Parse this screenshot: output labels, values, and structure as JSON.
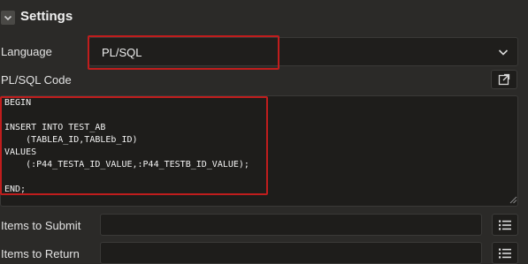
{
  "settings": {
    "title": "Settings",
    "toggle_icon": "chevron-down-icon"
  },
  "language": {
    "label": "Language",
    "value": "PL/SQL",
    "dropdown_icon": "chevron-down-icon"
  },
  "code": {
    "label": "PL/SQL Code",
    "expand_icon": "expand-icon",
    "text": "BEGIN\n\nINSERT INTO TEST_AB\n    (TABLEA_ID,TABLEb_ID)\nVALUES\n    (:P44_TESTA_ID_VALUE,:P44_TESTB_ID_VALUE);\n\nEND;"
  },
  "items_to_submit": {
    "label": "Items to Submit",
    "value": "",
    "list_icon": "list-icon"
  },
  "items_to_return": {
    "label": "Items to Return",
    "value": "",
    "list_icon": "list-icon"
  },
  "colors": {
    "highlight": "#c01d1d",
    "background": "#2b2a28",
    "field": "#1e1d1b"
  }
}
